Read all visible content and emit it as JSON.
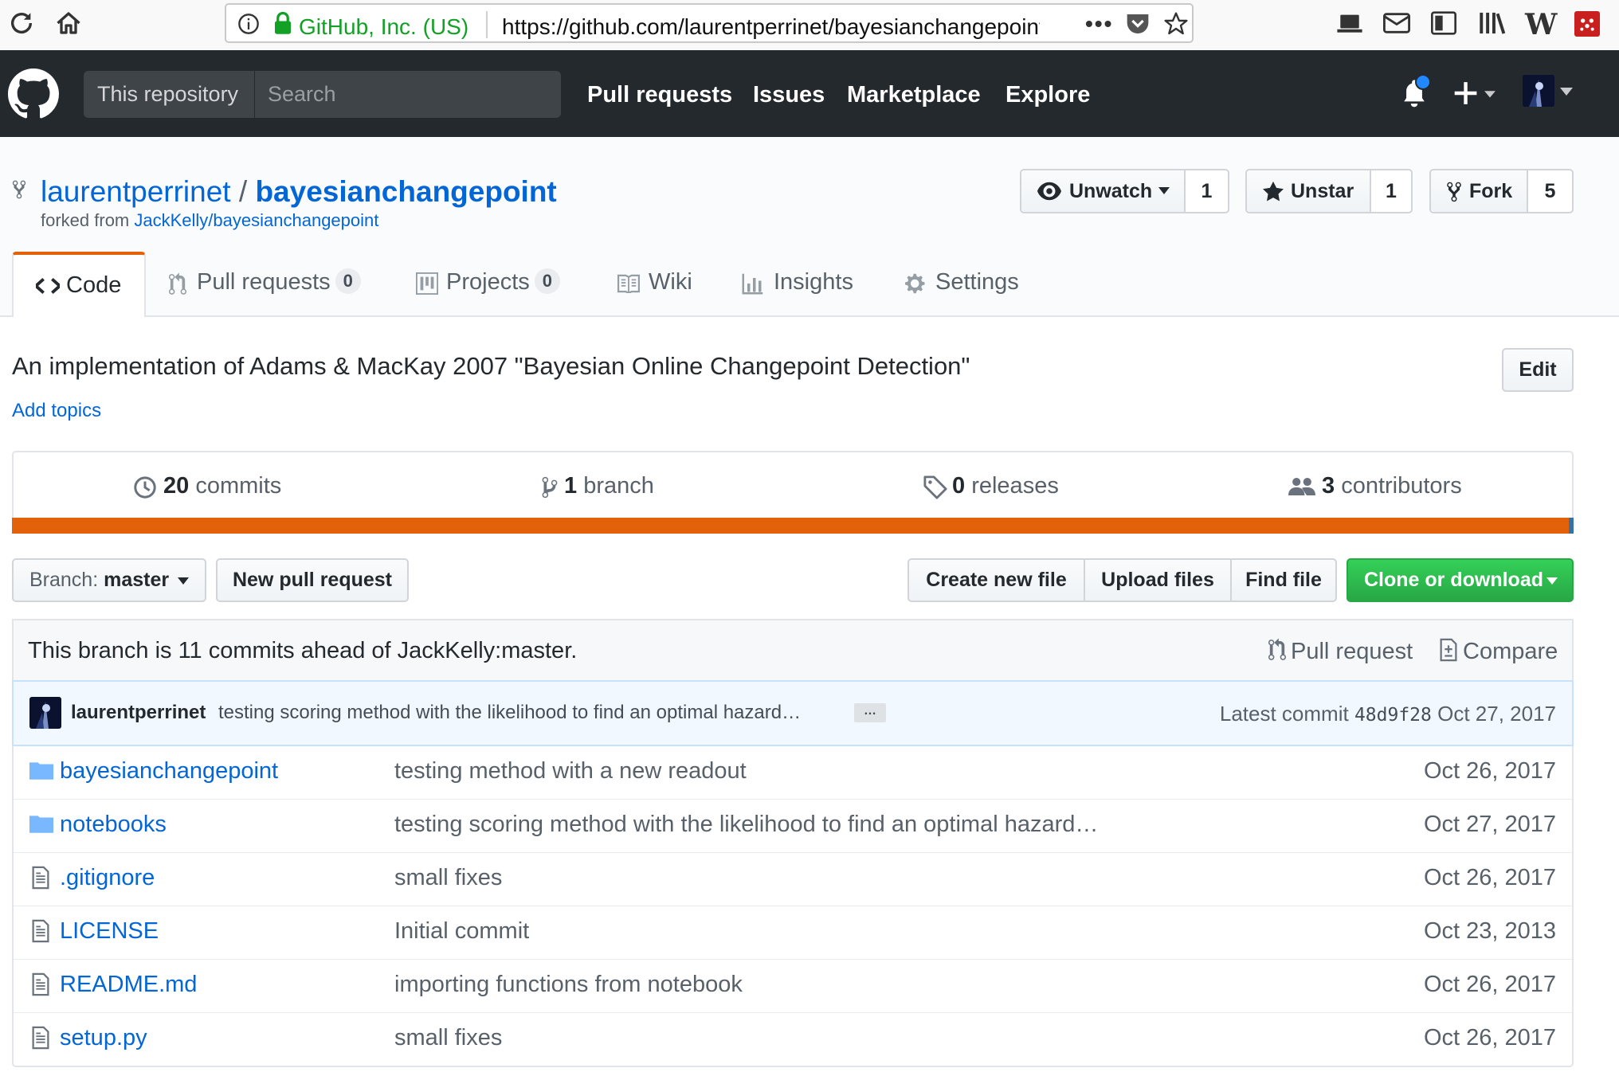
{
  "browser": {
    "cert_label": "GitHub, Inc. (US)",
    "url": "https://github.com/laurentperrinet/bayesianchangepoint"
  },
  "header": {
    "scope_label": "This repository",
    "search_placeholder": "Search",
    "nav": [
      "Pull requests",
      "Issues",
      "Marketplace",
      "Explore"
    ]
  },
  "repo": {
    "owner": "laurentperrinet",
    "separator": "/",
    "name": "bayesianchangepoint",
    "forked_prefix": "forked from",
    "forked_from": "JackKelly/bayesianchangepoint",
    "watch": {
      "label": "Unwatch",
      "count": "1"
    },
    "star": {
      "label": "Unstar",
      "count": "1"
    },
    "fork": {
      "label": "Fork",
      "count": "5"
    }
  },
  "tabs": [
    {
      "label": "Code",
      "count": null
    },
    {
      "label": "Pull requests",
      "count": "0"
    },
    {
      "label": "Projects",
      "count": "0"
    },
    {
      "label": "Wiki",
      "count": null
    },
    {
      "label": "Insights",
      "count": null
    },
    {
      "label": "Settings",
      "count": null
    }
  ],
  "description": "An implementation of Adams & MacKay 2007 \"Bayesian Online Changepoint Detection\"",
  "edit_label": "Edit",
  "add_topics": "Add topics",
  "summary": {
    "commits": {
      "num": "20",
      "label": "commits"
    },
    "branches": {
      "num": "1",
      "label": "branch"
    },
    "releases": {
      "num": "0",
      "label": "releases"
    },
    "contributors": {
      "num": "3",
      "label": "contributors"
    }
  },
  "language_colors": {
    "primary": "#e36209",
    "secondary": "#3572a5"
  },
  "file_nav": {
    "branch_prefix": "Branch:",
    "branch": "master",
    "new_pr": "New pull request",
    "create_file": "Create new file",
    "upload_files": "Upload files",
    "find_file": "Find file",
    "clone": "Clone or download"
  },
  "branch_info": {
    "text": "This branch is 11 commits ahead of JackKelly:master.",
    "pull_request": "Pull request",
    "compare": "Compare"
  },
  "latest_commit": {
    "author": "laurentperrinet",
    "message": "testing scoring method with the likelihood to find an optimal hazard…",
    "ellipsis": "…",
    "prefix": "Latest commit",
    "sha": "48d9f28",
    "date": "Oct 27, 2017"
  },
  "files": [
    {
      "type": "dir",
      "name": "bayesianchangepoint",
      "message": "testing method with a new readout",
      "date": "Oct 26, 2017"
    },
    {
      "type": "dir",
      "name": "notebooks",
      "message": "testing scoring method with the likelihood to find an optimal hazard…",
      "date": "Oct 27, 2017"
    },
    {
      "type": "file",
      "name": ".gitignore",
      "message": "small fixes",
      "date": "Oct 26, 2017"
    },
    {
      "type": "file",
      "name": "LICENSE",
      "message": "Initial commit",
      "date": "Oct 23, 2013"
    },
    {
      "type": "file",
      "name": "README.md",
      "message": "importing functions from notebook",
      "date": "Oct 26, 2017"
    },
    {
      "type": "file",
      "name": "setup.py",
      "message": "small fixes",
      "date": "Oct 26, 2017"
    }
  ]
}
